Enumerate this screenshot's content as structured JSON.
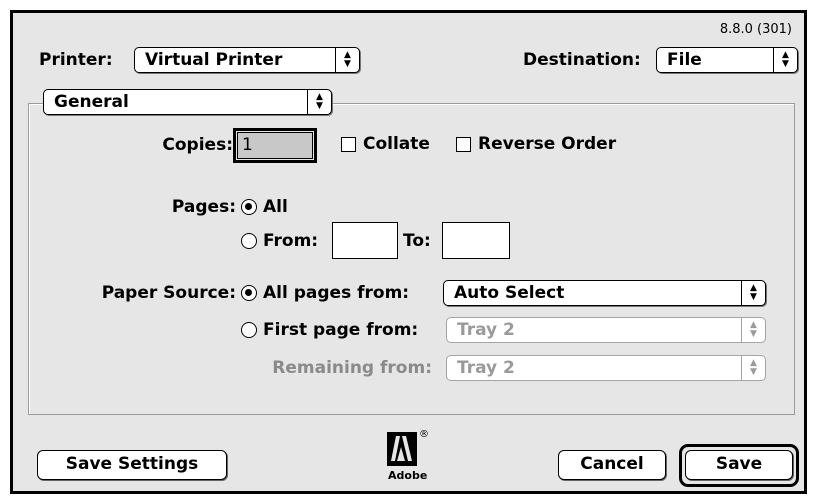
{
  "version": "8.8.0 (301)",
  "printer": {
    "label": "Printer:",
    "value": "Virtual Printer"
  },
  "destination": {
    "label": "Destination:",
    "value": "File"
  },
  "panel": {
    "value": "General"
  },
  "copies": {
    "label": "Copies:",
    "value": "1",
    "collate_label": "Collate",
    "reverse_label": "Reverse Order",
    "collate_checked": false,
    "reverse_checked": false
  },
  "pages": {
    "label": "Pages:",
    "all_label": "All",
    "from_label": "From:",
    "to_label": "To:",
    "from_value": "",
    "to_value": "",
    "selected": "All"
  },
  "paper_source": {
    "label": "Paper Source:",
    "all_pages_label": "All pages from:",
    "all_pages_value": "Auto Select",
    "first_page_label": "First page from:",
    "first_page_value": "Tray 2",
    "remaining_label": "Remaining from:",
    "remaining_value": "Tray 2",
    "selected": "All pages from:"
  },
  "buttons": {
    "save_settings": "Save Settings",
    "cancel": "Cancel",
    "save": "Save"
  },
  "logo": {
    "text": "Adobe",
    "mark": "®"
  },
  "colors": {
    "dialog_bg": "#e6e6e6",
    "disabled_text": "#8a8a8a"
  }
}
